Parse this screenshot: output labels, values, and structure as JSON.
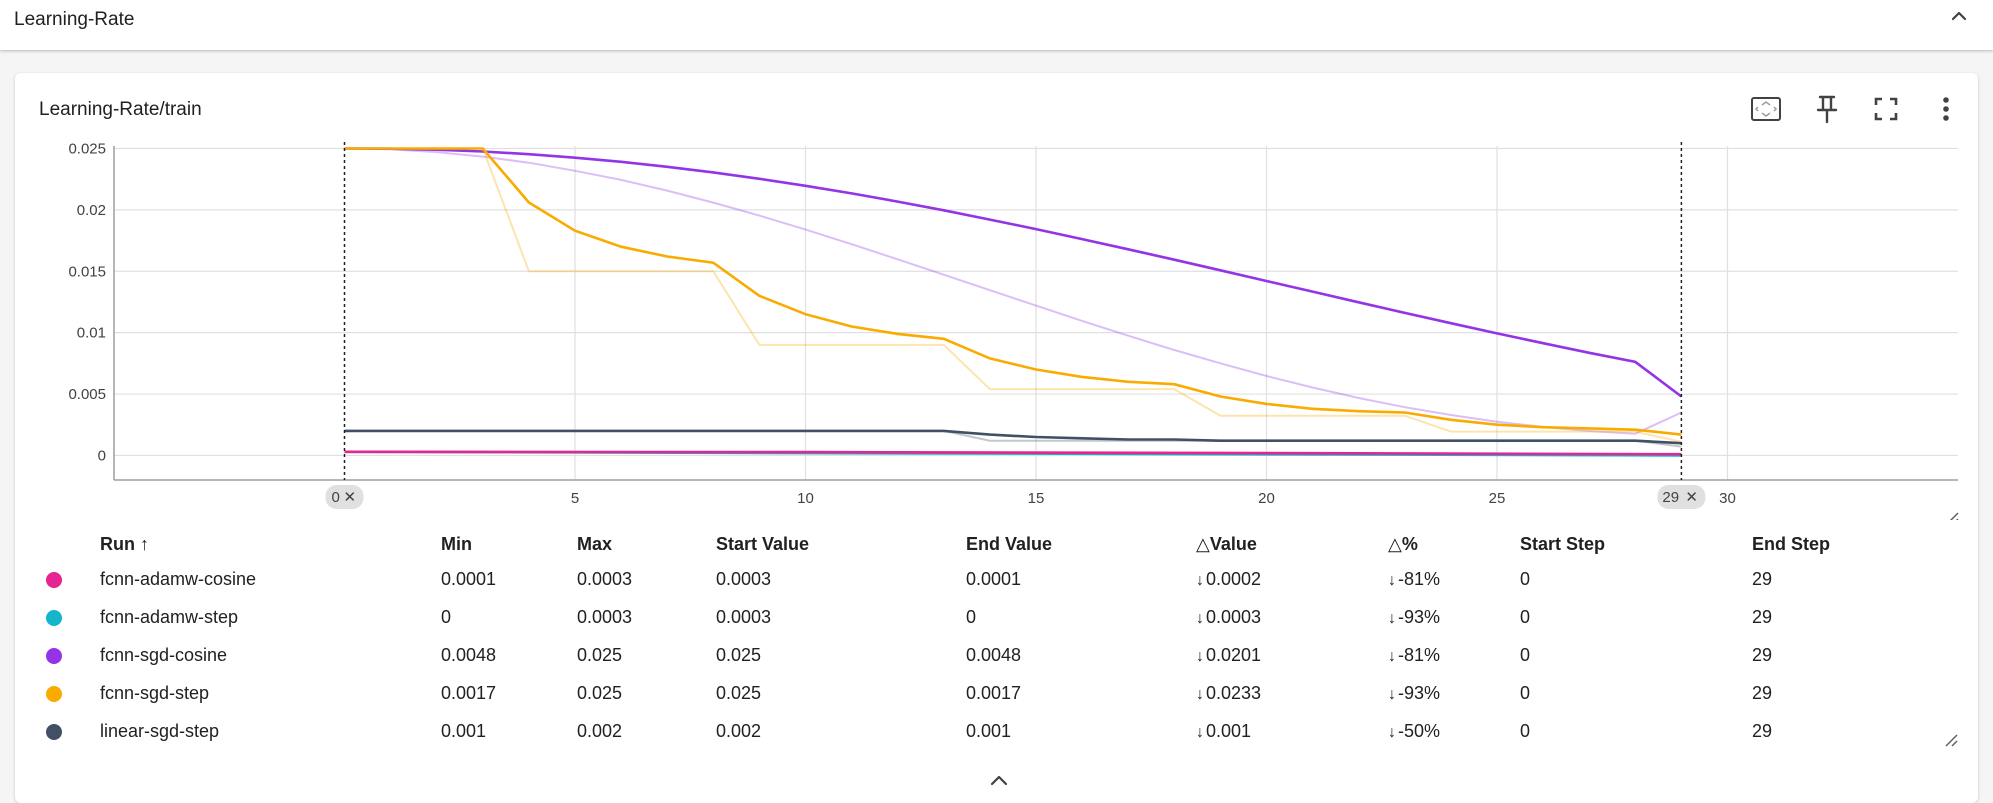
{
  "section": {
    "title": "Learning-Rate"
  },
  "card": {
    "title": "Learning-Rate/train"
  },
  "toolbar": {
    "icons": [
      "fit-to-domain-icon",
      "pin-icon",
      "fullscreen-icon",
      "more-vert-icon"
    ]
  },
  "colors": {
    "fcnn-adamw-cosine": "#e52592",
    "fcnn-adamw-step": "#12b5cb",
    "fcnn-sgd-cosine": "#9334e6",
    "fcnn-sgd-step": "#f9ab00",
    "linear-sgd-step": "#425066"
  },
  "step_markers": {
    "start": "0",
    "end": "29"
  },
  "chart_data": {
    "type": "line",
    "xlim": [
      -5,
      35
    ],
    "ylim": [
      -0.002,
      0.0252
    ],
    "x_ticks": [
      5,
      10,
      15,
      20,
      25,
      30
    ],
    "y_ticks": [
      0,
      0.005,
      0.01,
      0.015,
      0.02,
      0.025
    ],
    "y_tick_labels": [
      "0",
      "0.005",
      "0.01",
      "0.015",
      "0.02",
      "0.025"
    ],
    "grid": true,
    "series": [
      {
        "name": "fcnn-sgd-cosine",
        "color": "#9334e6",
        "x": [
          0,
          1,
          2,
          3,
          4,
          5,
          6,
          7,
          8,
          9,
          10,
          11,
          12,
          13,
          14,
          15,
          16,
          17,
          18,
          19,
          20,
          21,
          22,
          23,
          24,
          25,
          26,
          27,
          28,
          29
        ],
        "raw": [
          0.025,
          0.02493,
          0.0247,
          0.02434,
          0.02384,
          0.02318,
          0.02244,
          0.02157,
          0.02059,
          0.01953,
          0.01839,
          0.0172,
          0.01597,
          0.01472,
          0.01346,
          0.0122,
          0.01096,
          0.00975,
          0.00859,
          0.0075,
          0.00647,
          0.00553,
          0.00468,
          0.00393,
          0.00329,
          0.00275,
          0.00232,
          0.00199,
          0.00177,
          0.0035
        ],
        "smoothed": [
          0.025,
          0.02498,
          0.0249,
          0.02475,
          0.02453,
          0.02425,
          0.02391,
          0.02351,
          0.02305,
          0.02253,
          0.02196,
          0.02134,
          0.02067,
          0.01996,
          0.01921,
          0.01843,
          0.01762,
          0.01679,
          0.01594,
          0.01508,
          0.01421,
          0.01334,
          0.01247,
          0.01161,
          0.01077,
          0.00994,
          0.00914,
          0.00836,
          0.00762,
          0.0048
        ]
      },
      {
        "name": "fcnn-sgd-step",
        "color": "#f9ab00",
        "x": [
          0,
          1,
          2,
          3,
          4,
          5,
          6,
          7,
          8,
          9,
          10,
          11,
          12,
          13,
          14,
          15,
          16,
          17,
          18,
          19,
          20,
          21,
          22,
          23,
          24,
          25,
          26,
          27,
          28,
          29
        ],
        "raw": [
          0.025,
          0.025,
          0.025,
          0.025,
          0.015,
          0.015,
          0.015,
          0.015,
          0.015,
          0.009,
          0.009,
          0.009,
          0.009,
          0.009,
          0.0054,
          0.0054,
          0.0054,
          0.0054,
          0.0054,
          0.00324,
          0.00324,
          0.00324,
          0.00324,
          0.00324,
          0.00194,
          0.00194,
          0.00194,
          0.00194,
          0.00194,
          0.0011
        ],
        "smoothed": [
          0.025,
          0.025,
          0.025,
          0.025,
          0.0206,
          0.0183,
          0.017,
          0.0162,
          0.0157,
          0.013,
          0.0115,
          0.0105,
          0.0099,
          0.0095,
          0.0079,
          0.007,
          0.0064,
          0.006,
          0.0058,
          0.0048,
          0.0042,
          0.0038,
          0.0036,
          0.0035,
          0.0029,
          0.0025,
          0.0023,
          0.0022,
          0.0021,
          0.0017
        ]
      },
      {
        "name": "linear-sgd-step",
        "color": "#425066",
        "x": [
          0,
          1,
          2,
          3,
          4,
          5,
          6,
          7,
          8,
          9,
          10,
          11,
          12,
          13,
          14,
          15,
          16,
          17,
          18,
          19,
          20,
          21,
          22,
          23,
          24,
          25,
          26,
          27,
          28,
          29
        ],
        "raw": [
          0.002,
          0.002,
          0.002,
          0.002,
          0.002,
          0.002,
          0.002,
          0.002,
          0.002,
          0.002,
          0.002,
          0.002,
          0.002,
          0.002,
          0.0012,
          0.0012,
          0.0012,
          0.0012,
          0.0012,
          0.0012,
          0.0012,
          0.0012,
          0.0012,
          0.0012,
          0.0012,
          0.0012,
          0.0012,
          0.0012,
          0.0012,
          0.00072
        ],
        "smoothed": [
          0.002,
          0.002,
          0.002,
          0.002,
          0.002,
          0.002,
          0.002,
          0.002,
          0.002,
          0.002,
          0.002,
          0.002,
          0.002,
          0.002,
          0.0017,
          0.0015,
          0.0014,
          0.0013,
          0.0013,
          0.0012,
          0.0012,
          0.0012,
          0.0012,
          0.0012,
          0.0012,
          0.0012,
          0.0012,
          0.0012,
          0.0012,
          0.001
        ]
      },
      {
        "name": "fcnn-adamw-step",
        "color": "#12b5cb",
        "x": [
          0,
          29
        ],
        "raw": [
          0.0003,
          0
        ],
        "smoothed": [
          0.0003,
          0.0
        ]
      },
      {
        "name": "fcnn-adamw-cosine",
        "color": "#e52592",
        "x": [
          0,
          10,
          20,
          29
        ],
        "raw": [
          0.0003,
          0.00025,
          0.00015,
          0.0001
        ],
        "smoothed": [
          0.0003,
          0.00027,
          0.00019,
          0.0001
        ]
      }
    ]
  },
  "table": {
    "headers": {
      "run": "Run ↑",
      "min": "Min",
      "max": "Max",
      "start_value": "Start Value",
      "end_value": "End Value",
      "delta_value": "Value",
      "delta_pct": "%",
      "start_step": "Start Step",
      "end_step": "End Step"
    },
    "rows": [
      {
        "run": "fcnn-adamw-cosine",
        "min": "0.0001",
        "max": "0.0003",
        "start_value": "0.0003",
        "end_value": "0.0001",
        "delta_value": "0.0002",
        "delta_pct": "-81%",
        "start_step": "0",
        "end_step": "29"
      },
      {
        "run": "fcnn-adamw-step",
        "min": "0",
        "max": "0.0003",
        "start_value": "0.0003",
        "end_value": "0",
        "delta_value": "0.0003",
        "delta_pct": "-93%",
        "start_step": "0",
        "end_step": "29"
      },
      {
        "run": "fcnn-sgd-cosine",
        "min": "0.0048",
        "max": "0.025",
        "start_value": "0.025",
        "end_value": "0.0048",
        "delta_value": "0.0201",
        "delta_pct": "-81%",
        "start_step": "0",
        "end_step": "29"
      },
      {
        "run": "fcnn-sgd-step",
        "min": "0.0017",
        "max": "0.025",
        "start_value": "0.025",
        "end_value": "0.0017",
        "delta_value": "0.0233",
        "delta_pct": "-93%",
        "start_step": "0",
        "end_step": "29"
      },
      {
        "run": "linear-sgd-step",
        "min": "0.001",
        "max": "0.002",
        "start_value": "0.002",
        "end_value": "0.001",
        "delta_value": "0.001",
        "delta_pct": "-50%",
        "start_step": "0",
        "end_step": "29"
      }
    ]
  }
}
